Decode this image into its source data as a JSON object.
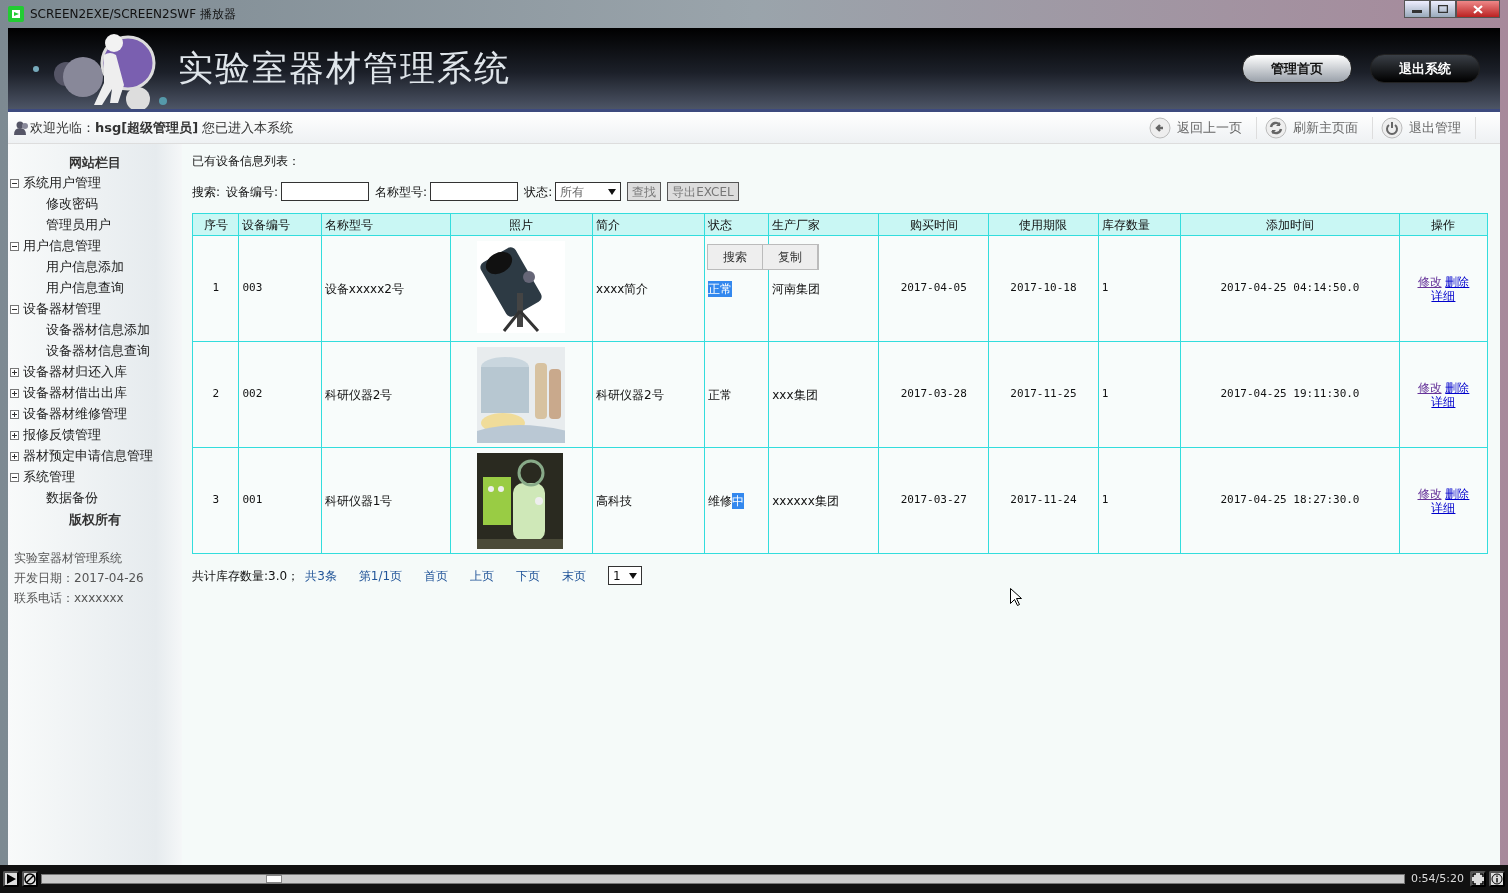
{
  "window": {
    "title": "SCREEN2EXE/SCREEN2SWF 播放器"
  },
  "header": {
    "title": "实验室器材管理系统",
    "buttons": [
      {
        "label": "管理首页",
        "kind": "light"
      },
      {
        "label": "退出系统",
        "kind": "dark"
      }
    ]
  },
  "welcome": {
    "text": "欢迎光临：**hsg[超级管理员]** 您已进入本系统"
  },
  "toolbar": [
    {
      "label": "返回上一页",
      "kind": "back"
    },
    {
      "label": "刷新主页面",
      "kind": "refresh"
    },
    {
      "label": "退出管理",
      "kind": "power"
    }
  ],
  "sidebar": {
    "heading": "网站栏目",
    "items": [
      {
        "label": "系统用户管理",
        "expanded": true,
        "children": [
          {
            "label": "修改密码"
          },
          {
            "label": "管理员用户"
          }
        ]
      },
      {
        "label": "用户信息管理",
        "expanded": true,
        "children": [
          {
            "label": "用户信息添加"
          },
          {
            "label": "用户信息查询"
          }
        ]
      },
      {
        "label": "设备器材管理",
        "expanded": true,
        "children": [
          {
            "label": "设备器材信息添加"
          },
          {
            "label": "设备器材信息查询"
          }
        ]
      },
      {
        "label": "设备器材归还入库",
        "expanded": false
      },
      {
        "label": "设备器材借出出库",
        "expanded": false
      },
      {
        "label": "设备器材维修管理",
        "expanded": false
      },
      {
        "label": "报修反馈管理",
        "expanded": false
      },
      {
        "label": "器材预定申请信息管理",
        "expanded": false
      },
      {
        "label": "系统管理",
        "expanded": true,
        "children": [
          {
            "label": "数据备份"
          }
        ]
      }
    ],
    "footer_heading": "版权所有",
    "footer_lines": [
      "实验室器材管理系统",
      "开发日期：2017-04-26",
      "联系电话：xxxxxxx"
    ]
  },
  "main": {
    "heading": "已有设备信息列表：",
    "search": {
      "label": "搜索:",
      "fields": [
        {
          "label": "设备编号:",
          "kind": "text"
        },
        {
          "label": "名称型号:",
          "kind": "text"
        },
        {
          "label": "状态:",
          "kind": "select",
          "value": "所有"
        }
      ],
      "buttons": [
        "查找",
        "导出EXCEL"
      ]
    },
    "table": {
      "columns": [
        "序号",
        "设备编号",
        "名称型号",
        "照片",
        "简介",
        "状态",
        "生产厂家",
        "购买时间",
        "使用期限",
        "库存数量",
        "添加时间",
        "操作"
      ],
      "rows": [
        {
          "cells": [
            "1",
            "003",
            "设备xxxxx2号",
            {
              "kind": "picture"
            },
            "xxxx简介",
            {
              "selected_text": "正常"
            },
            "河南集团",
            "2017-04-05",
            "2017-10-18",
            "1",
            "2017-04-25 04:14:50.0",
            [
              {
                "label": "修改",
                "visited": true
              },
              {
                "label": "删除",
                "visited": false
              },
              {
                "label": "详细",
                "visited": false
              }
            ]
          ]
        },
        {
          "cells": [
            "2",
            "002",
            "科研仪器2号",
            {
              "kind": "picture"
            },
            "科研仪器2号",
            {
              "text": "正常"
            },
            "xxx集团",
            "2017-03-28",
            "2017-11-25",
            "1",
            "2017-04-25 19:11:30.0",
            [
              {
                "label": "修改",
                "visited": true
              },
              {
                "label": "删除",
                "visited": false
              },
              {
                "label": "详细",
                "visited": false
              }
            ]
          ]
        },
        {
          "cells": [
            "3",
            "001",
            "科研仪器1号",
            {
              "kind": "picture"
            },
            "高科技",
            {
              "text": "维修",
              "selected_text": "中"
            },
            "xxxxxx集团",
            "2017-03-27",
            "2017-11-24",
            "1",
            "2017-04-25 18:27:30.0",
            [
              {
                "label": "修改",
                "visited": true
              },
              {
                "label": "删除",
                "visited": false
              },
              {
                "label": "详细",
                "visited": false
              }
            ]
          ]
        }
      ]
    },
    "selection_popup": [
      "搜索",
      "复制"
    ],
    "summary": "共计库存数量:3.0；",
    "pager": [
      "共3条",
      "第1/1页",
      "首页",
      "上页",
      "下页",
      "末页"
    ],
    "page_select": "1"
  },
  "player": {
    "time": "0:54/5:20",
    "level": 0.17
  }
}
